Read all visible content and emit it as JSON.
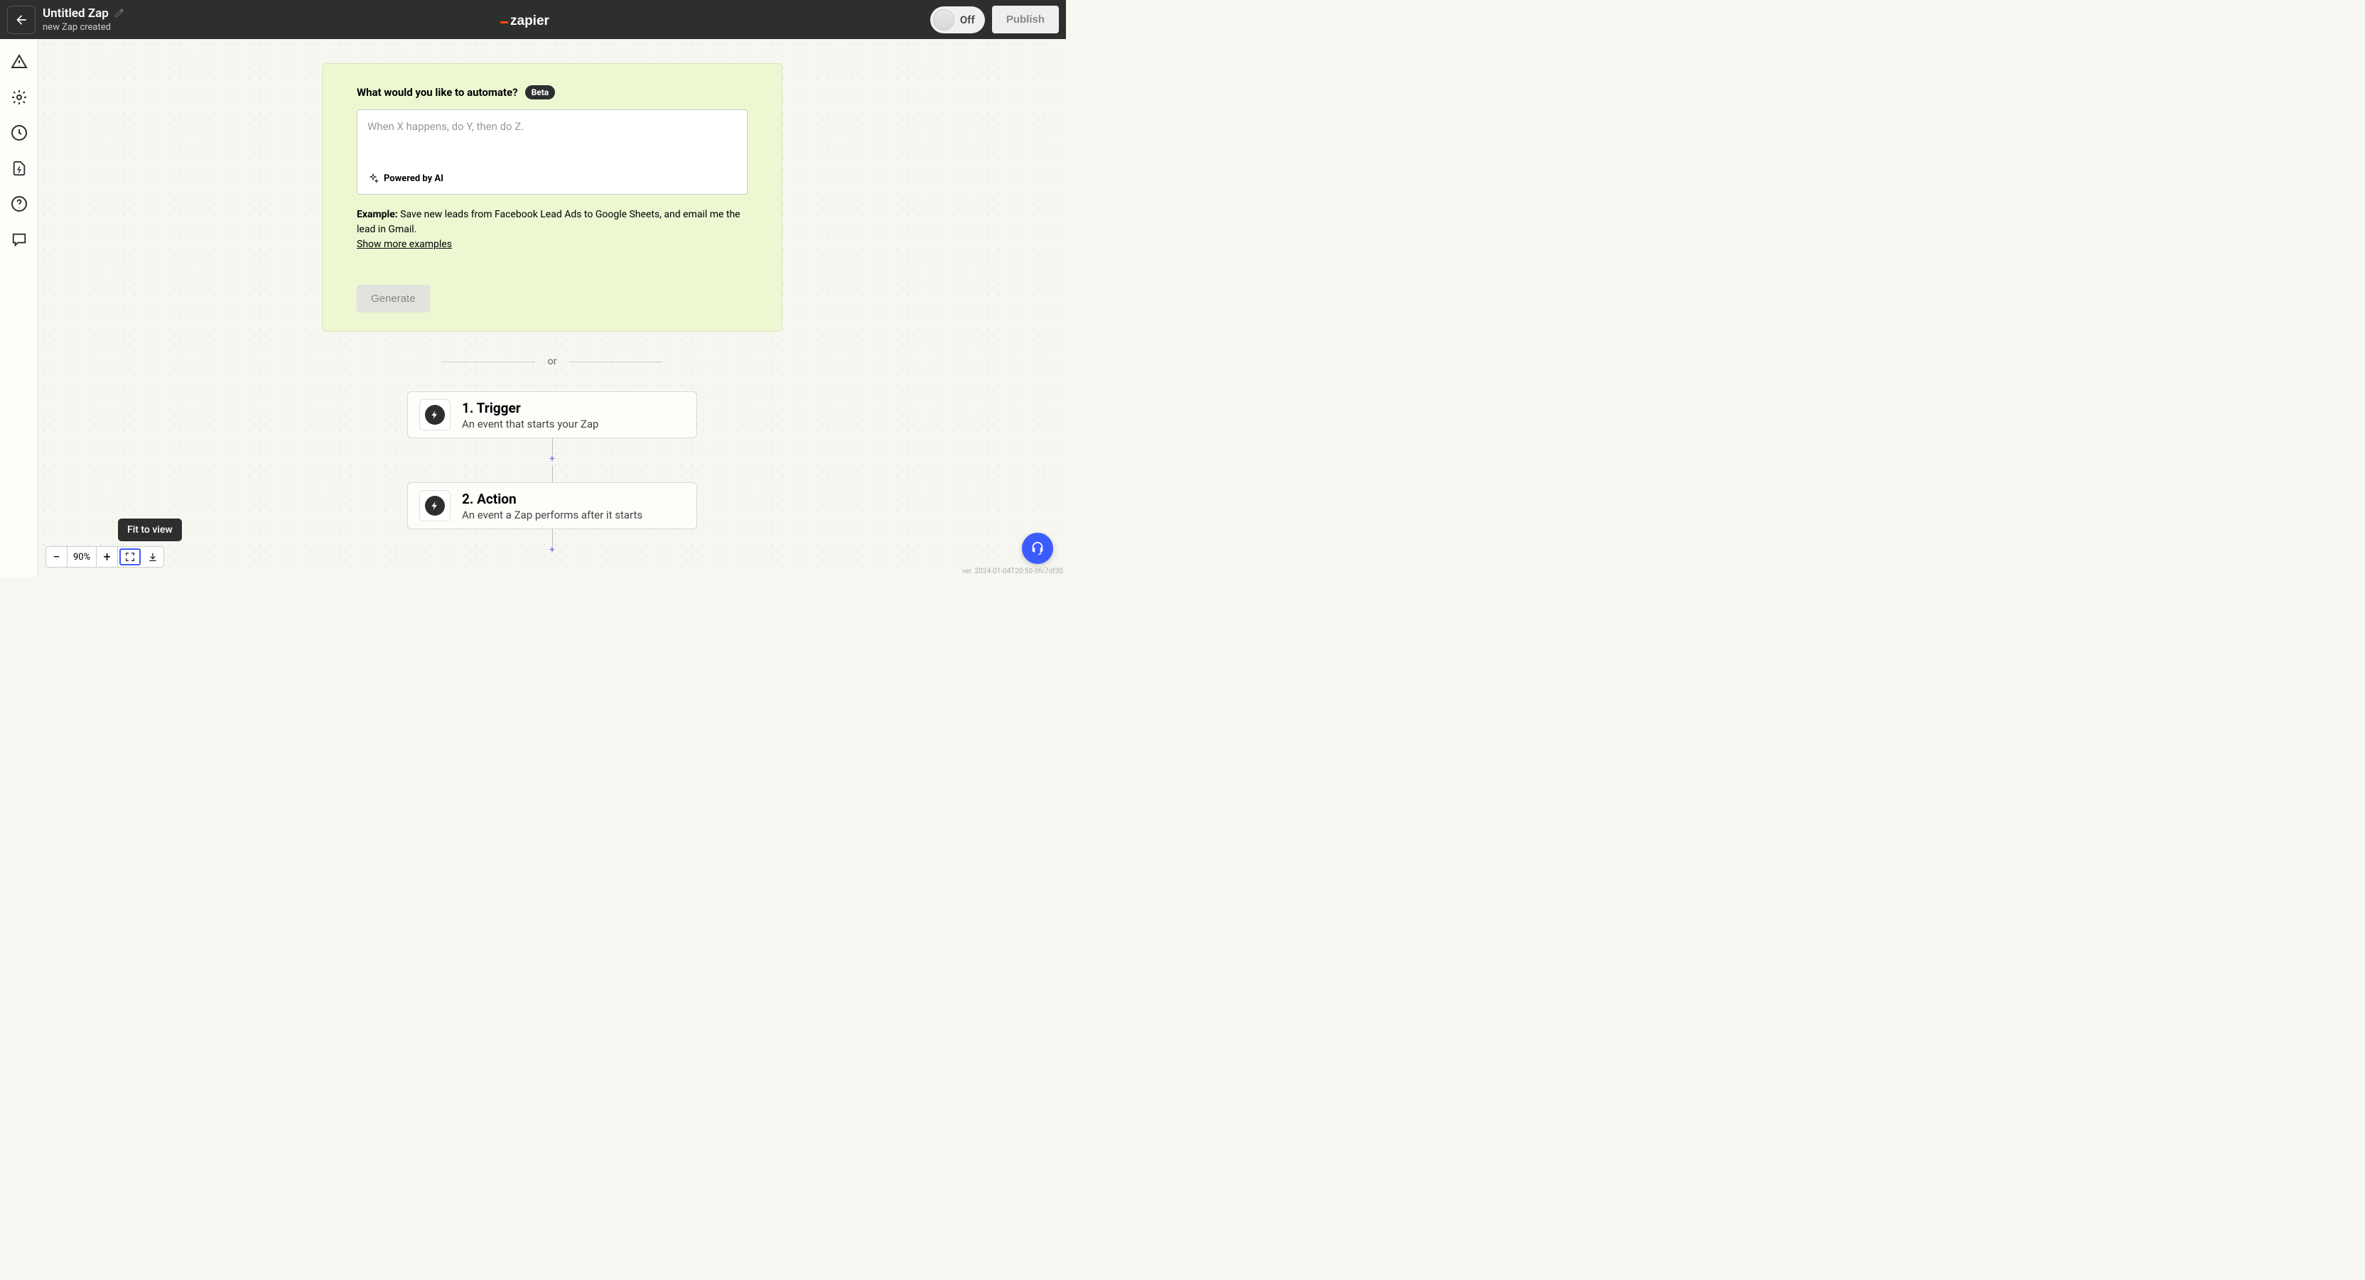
{
  "header": {
    "title": "Untitled Zap",
    "subtitle": "new Zap created",
    "toggle_label": "Off",
    "publish_label": "Publish"
  },
  "ai_panel": {
    "title": "What would you like to automate?",
    "badge": "Beta",
    "placeholder": "When X happens, do Y, then do Z.",
    "powered_label": "Powered by AI",
    "example_label": "Example:",
    "example_text": " Save new leads from Facebook Lead Ads to Google Sheets, and email me the lead in Gmail.",
    "show_more": "Show more examples",
    "generate_label": "Generate"
  },
  "divider": {
    "or": "or"
  },
  "steps": [
    {
      "title": "1. Trigger",
      "subtitle": "An event that starts your Zap"
    },
    {
      "title": "2. Action",
      "subtitle": "An event a Zap performs after it starts"
    }
  ],
  "zoom": {
    "level": "90%",
    "tooltip": "Fit to view"
  },
  "version": "ver. 2024-01-04T20:50-9fc7df30"
}
